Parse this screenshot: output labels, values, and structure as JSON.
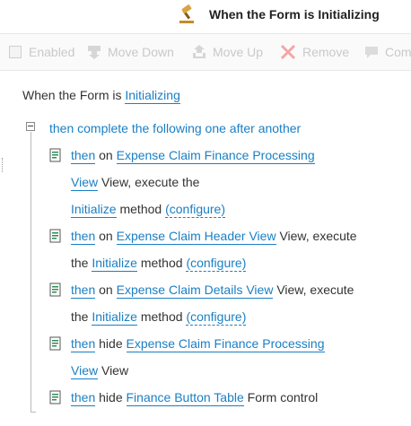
{
  "header": {
    "title": "When the Form is Initializing",
    "icon": "gavel-icon"
  },
  "toolbar": {
    "enabled_label": "Enabled",
    "move_down_label": "Move Down",
    "move_up_label": "Move Up",
    "remove_label": "Remove",
    "comment_label": "Com"
  },
  "rule": {
    "prefix": "When the Form is",
    "event_link": "Initializing",
    "group_title": "then complete the following one after another",
    "actions": [
      {
        "then": "then",
        "line1_text": "on",
        "view_link": "Expense Claim Finance Processing",
        "line2_link": "View",
        "line2_text": "View, execute the",
        "method_link": "Initialize",
        "method_text": "method",
        "configure": "(configure)"
      },
      {
        "then": "then",
        "line1_text": "on",
        "view_link": "Expense Claim Header View",
        "line1_suffix": "View, execute",
        "line2_prefix": "the",
        "method_link": "Initialize",
        "method_text": "method",
        "configure": "(configure)"
      },
      {
        "then": "then",
        "line1_text": "on",
        "view_link": "Expense Claim Details View",
        "line1_suffix": "View, execute",
        "line2_prefix": "the",
        "method_link": "Initialize",
        "method_text": "method",
        "configure": "(configure)"
      },
      {
        "then": "then",
        "line1_text": "hide",
        "view_link": "Expense Claim Finance Processing",
        "line2_link": "View",
        "line2_text": "View"
      },
      {
        "then": "then",
        "line1_text": "hide",
        "control_link": "Finance Button Table",
        "line1_suffix": "Form control"
      }
    ]
  },
  "colors": {
    "link": "#1a7fc4",
    "toolbar_disabled": "#c9c9c9"
  }
}
